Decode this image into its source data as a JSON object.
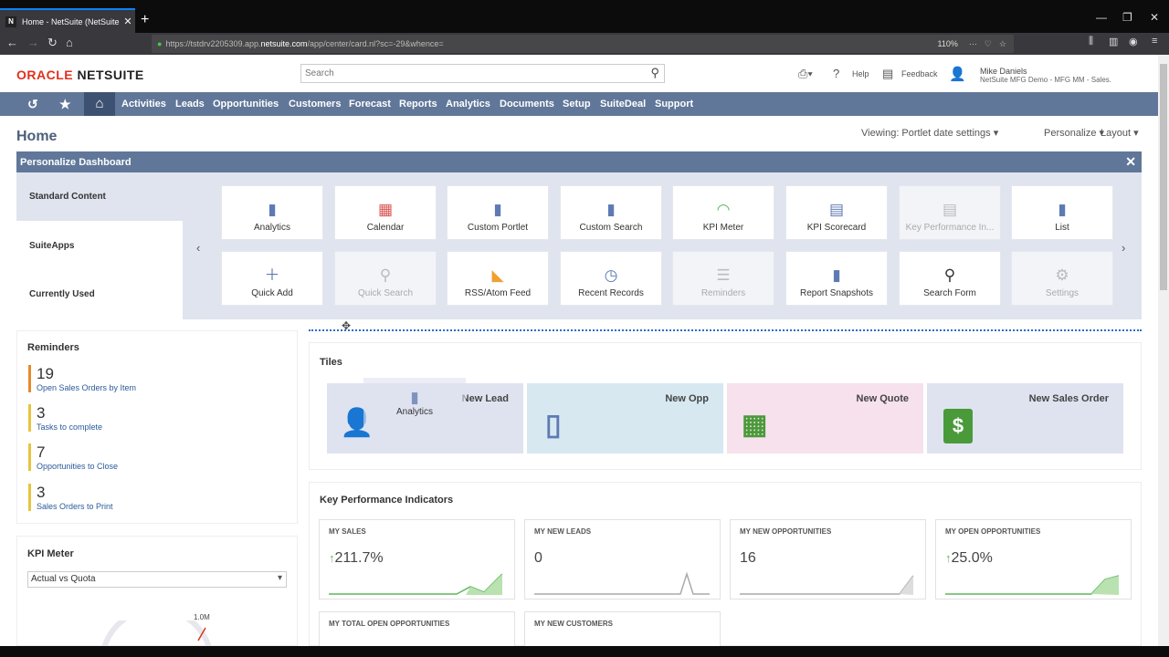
{
  "browser": {
    "tab_title": "Home - NetSuite (NetSuite MF",
    "tab_icon": "N",
    "url_prefix": "https://tstdrv2205309.app.",
    "url_host": "netsuite.com",
    "url_path": "/app/center/card.nl?sc=-29&whence=",
    "zoom": "110%"
  },
  "header": {
    "logo_oracle": "ORACLE",
    "logo_netsuite": "NETSUITE",
    "search_placeholder": "Search",
    "help": "Help",
    "feedback": "Feedback",
    "user_name": "Mike Daniels",
    "user_role": "NetSuite MFG Demo - MFG MM - Sales."
  },
  "menu": [
    "Activities",
    "Leads",
    "Opportunities",
    "Customers",
    "Forecast",
    "Reports",
    "Analytics",
    "Documents",
    "Setup",
    "SuiteDeal",
    "Support"
  ],
  "page": {
    "title": "Home",
    "viewing": "Viewing: Portlet date settings",
    "personalize": "Personalize",
    "layout": "Layout"
  },
  "dashboard": {
    "title": "Personalize Dashboard",
    "categories": [
      "Standard Content",
      "SuiteApps",
      "Currently Used"
    ],
    "tiles_row1": [
      "Analytics",
      "Calendar",
      "Custom Portlet",
      "Custom Search",
      "KPI Meter",
      "KPI Scorecard",
      "Key Performance In...",
      "List"
    ],
    "tiles_row2": [
      "Quick Add",
      "Quick Search",
      "RSS/Atom Feed",
      "Recent Records",
      "Reminders",
      "Report Snapshots",
      "Search Form",
      "Settings"
    ]
  },
  "reminders": {
    "title": "Reminders",
    "items": [
      {
        "n": "19",
        "label": "Open Sales Orders by Item"
      },
      {
        "n": "3",
        "label": "Tasks to complete"
      },
      {
        "n": "7",
        "label": "Opportunities to Close"
      },
      {
        "n": "3",
        "label": "Sales Orders to Print"
      }
    ]
  },
  "kpi_meter": {
    "title": "KPI Meter",
    "select": "Actual vs Quota",
    "gauge_max": "1.0M"
  },
  "tiles": {
    "title": "Tiles",
    "drag_label": "Analytics",
    "items": [
      {
        "label": "New Lead",
        "color": "#dfe3f0"
      },
      {
        "label": "New Opp",
        "color": "#d7e8f1"
      },
      {
        "label": "New Quote",
        "color": "#f6e1ec"
      },
      {
        "label": "New Sales Order",
        "color": "#dfe3f0"
      }
    ]
  },
  "kpi": {
    "title": "Key Performance Indicators",
    "cards": [
      {
        "label": "MY SALES",
        "value": "211.7%",
        "arrow": "↑"
      },
      {
        "label": "MY NEW LEADS",
        "value": "0",
        "arrow": ""
      },
      {
        "label": "MY NEW OPPORTUNITIES",
        "value": "16",
        "arrow": ""
      },
      {
        "label": "MY OPEN OPPORTUNITIES",
        "value": "25.0%",
        "arrow": "↑"
      },
      {
        "label": "MY TOTAL OPEN OPPORTUNITIES",
        "value": "",
        "arrow": ""
      },
      {
        "label": "MY NEW CUSTOMERS",
        "value": "",
        "arrow": ""
      }
    ]
  },
  "colors": {
    "accent": "#607799",
    "brand_red": "#e0301e",
    "spark_green": "#5cb85c"
  }
}
